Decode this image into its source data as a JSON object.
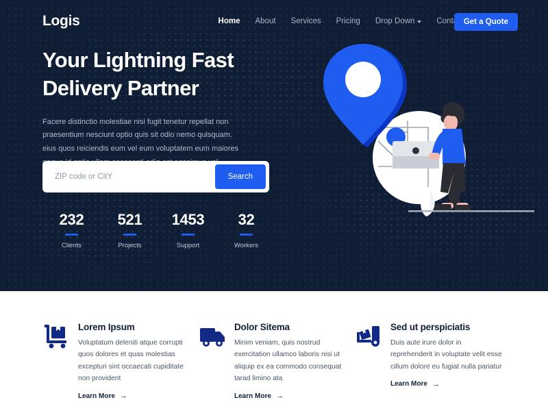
{
  "brand": {
    "logo": "Logis",
    "accent": "#1f5cf0",
    "dark": "#0f1e34",
    "icon_blue": "#122a86"
  },
  "nav": {
    "items": [
      {
        "label": "Home",
        "active": true,
        "dropdown": false
      },
      {
        "label": "About",
        "active": false,
        "dropdown": false
      },
      {
        "label": "Services",
        "active": false,
        "dropdown": false
      },
      {
        "label": "Pricing",
        "active": false,
        "dropdown": false
      },
      {
        "label": "Drop Down",
        "active": false,
        "dropdown": true
      },
      {
        "label": "Contact",
        "active": false,
        "dropdown": false
      }
    ],
    "cta": "Get a Quote"
  },
  "hero": {
    "title": "Your Lightning Fast\nDelivery Partner",
    "description": "Facere distinctio molestiae nisi fugit tenetur repellat non praesentium nesciunt optio quis sit odio nemo quisquam. eius quos reiciendis eum vel eum voluptatem eum maiores eaque id optio ullam occaecati odio est possimus vel reprehenderit",
    "search": {
      "placeholder": "ZIP code or CitY",
      "value": "",
      "button": "Search"
    },
    "stats": [
      {
        "value": "232",
        "label": "Clients"
      },
      {
        "value": "521",
        "label": "Projects"
      },
      {
        "value": "1453",
        "label": "Support"
      },
      {
        "value": "32",
        "label": "Workers"
      }
    ]
  },
  "cards": [
    {
      "icon": "hand-truck-icon",
      "title": "Lorem Ipsum",
      "text": "Voluptatum deleniti atque corrupti quos dolores et quas molestias excepturi sint occaecati cupiditate non provident",
      "link": "Learn More",
      "arrow": "→"
    },
    {
      "icon": "delivery-truck-icon",
      "title": "Dolor Sitema",
      "text": "Minim veniam, quis nostrud exercitation ullamco laboris nisi ut aliquip ex ea commodo consequat tarad limino ata",
      "link": "Learn More",
      "arrow": "→"
    },
    {
      "icon": "forklift-icon",
      "title": "Sed ut perspiciatis",
      "text": "Duis aute irure dolor in reprehenderit in voluptate velit esse cillum dolore eu fugiat nulla pariatur",
      "link": "Learn More",
      "arrow": "→"
    }
  ]
}
